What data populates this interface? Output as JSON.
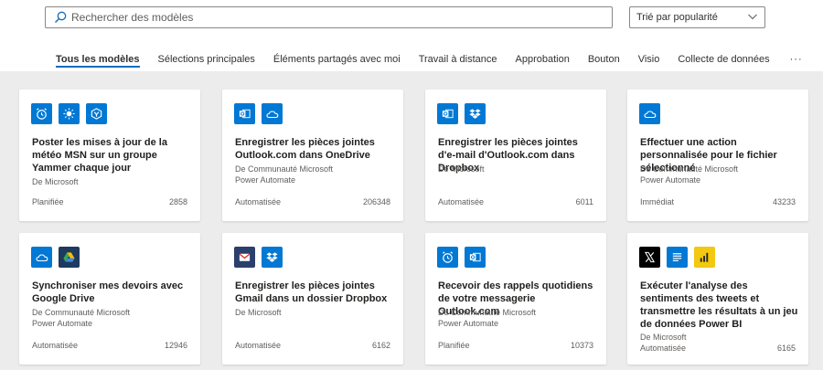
{
  "search": {
    "placeholder": "Rechercher des modèles"
  },
  "sort": {
    "label": "Trié par popularité"
  },
  "tabs": [
    {
      "label": "Tous les modèles"
    },
    {
      "label": "Sélections principales"
    },
    {
      "label": "Éléments partagés avec moi"
    },
    {
      "label": "Travail à distance"
    },
    {
      "label": "Approbation"
    },
    {
      "label": "Bouton"
    },
    {
      "label": "Visio"
    },
    {
      "label": "Collecte de données"
    },
    {
      "label": "···"
    }
  ],
  "cards": [
    {
      "title": "Poster les mises à jour de la météo MSN sur un groupe Yammer chaque jour",
      "author_line1": "De Microsoft",
      "author_line2": "",
      "type": "Planifiée",
      "count": "2858",
      "icons": [
        "alarm-clock-icon",
        "sun-weather-icon",
        "yammer-icon"
      ]
    },
    {
      "title": "Enregistrer les pièces jointes Outlook.com dans OneDrive",
      "author_line1": "De Communauté Microsoft",
      "author_line2": "Power Automate",
      "type": "Automatisée",
      "count": "206348",
      "icons": [
        "outlook-icon",
        "onedrive-icon"
      ]
    },
    {
      "title": "Enregistrer les pièces jointes d'e-mail d'Outlook.com dans Dropbox",
      "author_line1": "De Microsoft",
      "author_line2": "",
      "type": "Automatisée",
      "count": "6011",
      "icons": [
        "outlook-icon",
        "dropbox-icon"
      ]
    },
    {
      "title": "Effectuer une action personnalisée pour le fichier sélectionné",
      "author_line1": "De Communauté Microsoft",
      "author_line2": "Power Automate",
      "type": "Immédiat",
      "count": "43233",
      "icons": [
        "onedrive-icon"
      ]
    },
    {
      "title": "Synchroniser mes devoirs avec Google Drive",
      "author_line1": "De Communauté Microsoft",
      "author_line2": "Power Automate",
      "type": "Automatisée",
      "count": "12946",
      "icons": [
        "onedrive-icon",
        "google-drive-icon"
      ]
    },
    {
      "title": "Enregistrer les pièces jointes Gmail dans un dossier Dropbox",
      "author_line1": "De Microsoft",
      "author_line2": "",
      "type": "Automatisée",
      "count": "6162",
      "icons": [
        "gmail-icon",
        "dropbox-icon"
      ]
    },
    {
      "title": "Recevoir des rappels quotidiens de votre messagerie Outlook.com",
      "author_line1": "De Communauté Microsoft",
      "author_line2": "Power Automate",
      "type": "Planifiée",
      "count": "10373",
      "icons": [
        "alarm-clock-icon",
        "outlook-icon"
      ]
    },
    {
      "title": "Exécuter l'analyse des sentiments des tweets et transmettre les résultats à un jeu de données Power BI",
      "author_line1": "De Microsoft",
      "author_line2": "Automatisée",
      "type": "",
      "count": "6165",
      "icons": [
        "x-twitter-icon",
        "text-analytics-icon",
        "power-bi-icon"
      ]
    }
  ],
  "colors": {
    "accent": "#0f6cbd",
    "icon_blue": "#0078d4",
    "google_drive_bg": "#1e3a5f",
    "gmail_bg": "#2b3f6c",
    "x_bg": "#000000",
    "powerbi_bg": "#f2c811"
  }
}
